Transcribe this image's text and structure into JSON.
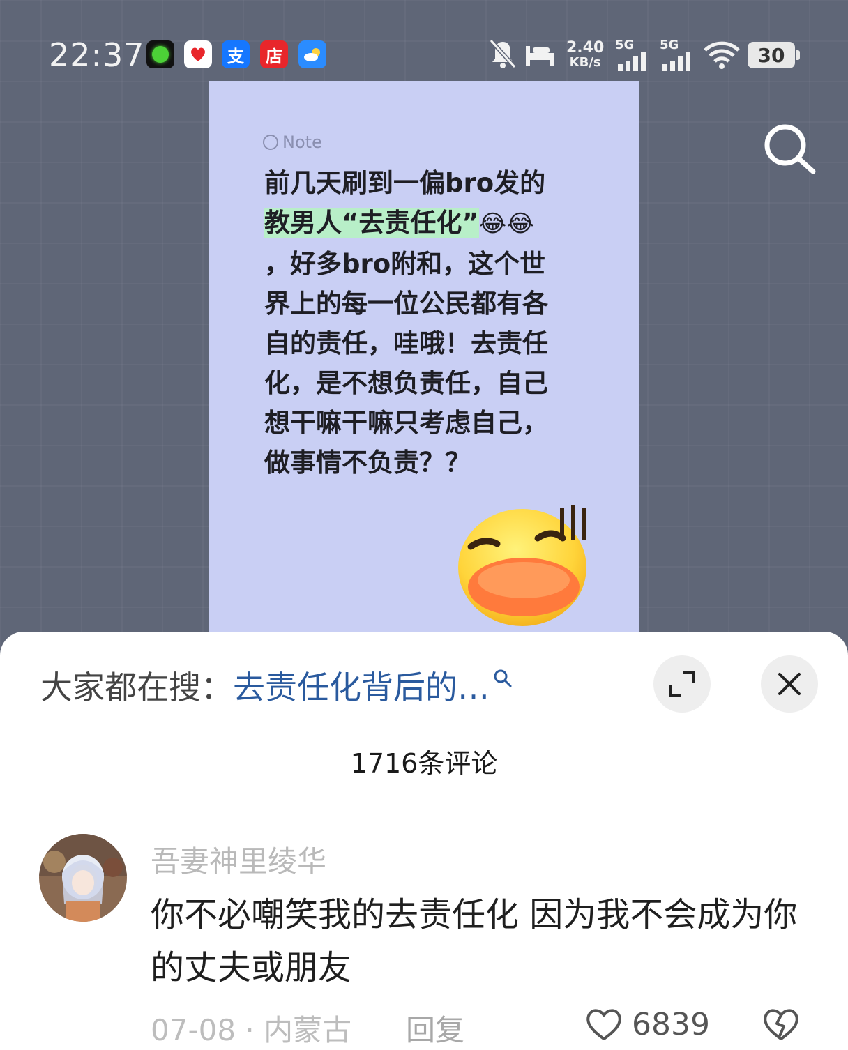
{
  "status_bar": {
    "time": "22:37",
    "app_icons": [
      {
        "name": "green-dot-app-icon",
        "label": "",
        "bg": "#111111"
      },
      {
        "name": "red-app-icon",
        "label": "",
        "bg": "#ffffff"
      },
      {
        "name": "alipay-app-icon",
        "label": "支",
        "bg": "#1677ff"
      },
      {
        "name": "store-app-icon",
        "label": "店",
        "bg": "#e8262b"
      },
      {
        "name": "weather-app-icon",
        "label": "",
        "bg": "#2b8cff"
      }
    ],
    "net_speed_value": "2.40",
    "net_speed_unit": "KB/s",
    "sim1": "5G",
    "sim2": "5G",
    "battery": "30"
  },
  "note": {
    "tag": "Note",
    "lines": [
      "前几天刷到一偏bro发的",
      "教男人“去责任化”",
      "，好多bro附和，这个世",
      "界上的每一位公民都有各",
      "自的责任，哇哦！去责任",
      "化，是不想负责任，自己",
      "想干嘛干嘛只考虑自己，",
      "做事情不负责？？"
    ],
    "emoji_small": "😂😂"
  },
  "sheet": {
    "hot_search_prefix": "大家都在搜：",
    "hot_search_query": "去责任化背后的…",
    "comment_count": "1716条评论"
  },
  "comment": {
    "username": "吾妻神里绫华",
    "text": "你不必嘲笑我的去责任化 因为我不会成为你的丈夫或朋友",
    "date": "07-08",
    "location": "内蒙古",
    "meta_separator": " · ",
    "reply_label": "回复",
    "like_count": "6839"
  },
  "colors": {
    "highlight": "#b8efc8",
    "card": "#c9cff4",
    "link": "#2a5a9e"
  }
}
